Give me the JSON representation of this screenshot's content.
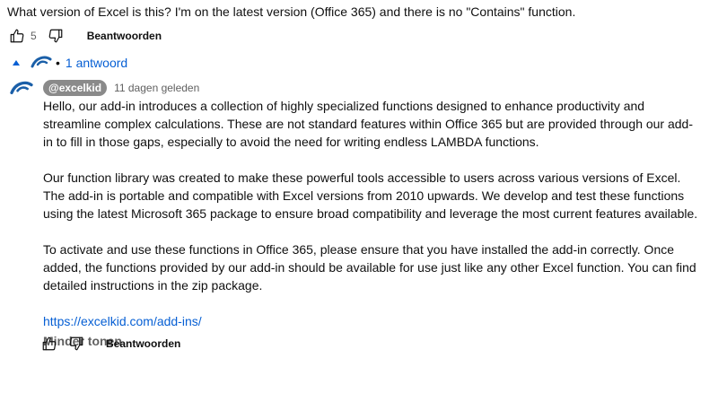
{
  "top_comment": {
    "text": "What version of Excel is this? I'm on the latest version (Office 365) and there is no \"Contains\" function.",
    "like_count": "5",
    "reply_label": "Beantwoorden"
  },
  "replies_toggle": {
    "label": "1 antwoord",
    "separator": "•"
  },
  "reply": {
    "author": "@excelkid",
    "timestamp": "11 dagen geleden",
    "paragraphs": [
      "Hello, our add-in introduces a collection of highly specialized functions designed to enhance productivity and streamline complex calculations. These are not standard features within Office 365 but are provided through our add-in to fill in those gaps, especially to avoid the need for writing endless LAMBDA functions.",
      "Our function library was created to make these powerful tools accessible to users across various versions of Excel. The add-in is portable and compatible with Excel versions from 2010 upwards. We develop and test these functions using the latest Microsoft 365 package to ensure broad compatibility and leverage the most current features available.",
      "To activate and use these functions in Office 365, please ensure that you have installed the add-in correctly. Once added, the functions provided by our add-in should be available for use just like any other Excel function. You can find detailed instructions in the zip package."
    ],
    "link": "https://excelkid.com/add-ins/",
    "show_less_label": "Minder tonen",
    "reply_label": "Beantwoorden"
  },
  "colors": {
    "link": "#065fd4",
    "badge_bg": "#8a8a8a",
    "logo_blue": "#1a5fa8"
  },
  "icons": [
    "like-icon",
    "dislike-icon",
    "caret-up-icon",
    "excelkid-logo-icon"
  ]
}
